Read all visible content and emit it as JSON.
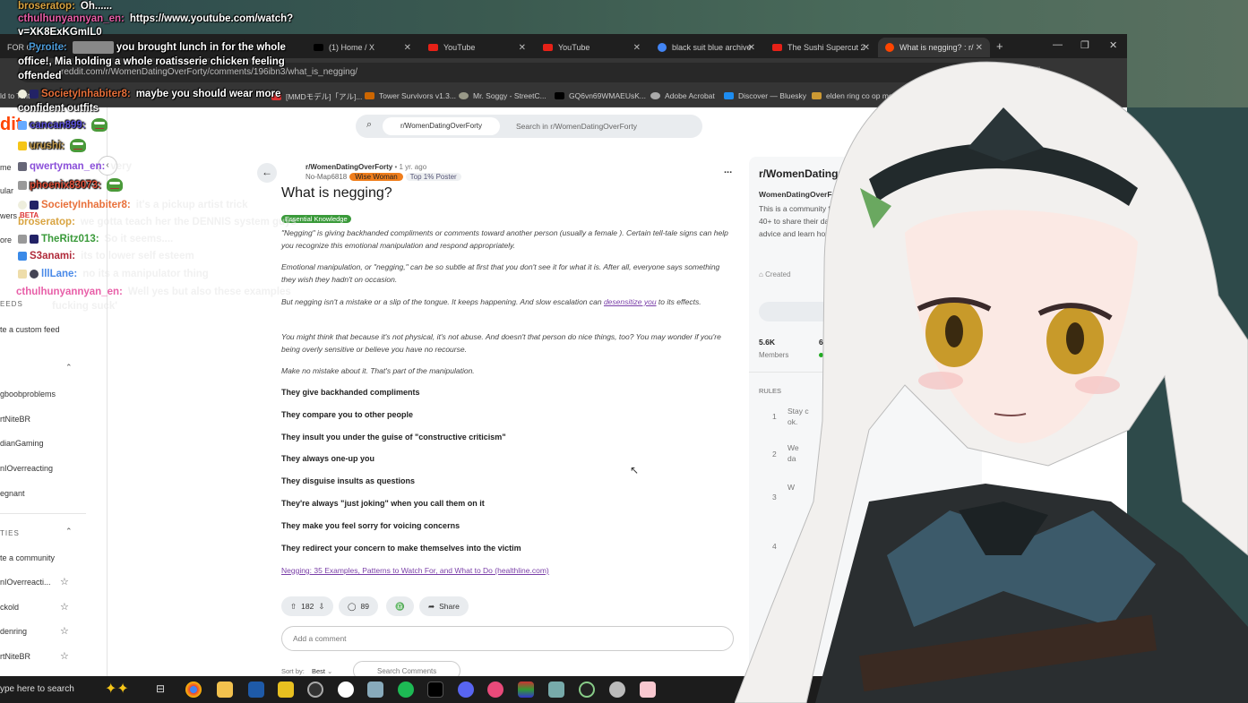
{
  "browser": {
    "tabs": [
      {
        "label": "FOR GASMAXX",
        "fav": "#888"
      },
      {
        "label": "(1) Home / X",
        "fav": "#000"
      },
      {
        "label": "YouTube",
        "fav": "#e62117"
      },
      {
        "label": "YouTube",
        "fav": "#e62117"
      },
      {
        "label": "black suit blue archive",
        "fav": "#4285f4"
      },
      {
        "label": "The Sushi Supercut 2",
        "fav": "#e62117"
      },
      {
        "label": "What is negging? : r/",
        "fav": "#ff4500"
      }
    ],
    "new_tab": "+",
    "url": "reddit.com/r/WomenDatingOverForty/comments/196ibn3/what_is_negging/",
    "bookmarks": [
      "ld to Twitch",
      "[MMDモデル]「アル]...",
      "Tower Survivors v1.3...",
      "Mr. Soggy - StreetC...",
      "GQ6vn69WMAEUsK...",
      "Adobe Acrobat",
      "Discover — Bluesky",
      "elden ring co op mod"
    ]
  },
  "reddit": {
    "logo": "dit",
    "search_chip": "r/WomenDatingOverForty",
    "search_placeholder": "Search in r/WomenDatingOverForty",
    "sidebar": {
      "top": [
        "me",
        "ular",
        "wers",
        "ore"
      ],
      "beta": "BETA",
      "feeds_header": "EEDS",
      "custom_feed": "te a custom feed",
      "recent": [
        "gboobproblems",
        "rtNiteBR",
        "dianGaming",
        "nIOverreacting",
        "egnant"
      ],
      "communities_header": "TIES",
      "create_community": "te a community",
      "communities": [
        "nIOverreacti...",
        "ckold",
        "denring",
        "rtNiteBR"
      ]
    },
    "post": {
      "subreddit": "r/WomenDatingOverForty",
      "age": "• 1 yr. ago",
      "author": "No-Map6818",
      "flair_user": "Wise Woman",
      "top_poster": "Top 1% Poster",
      "title": "What is negging?",
      "flair": "Essential Knowledge",
      "paragraphs": [
        "\"Negging\" is giving backhanded compliments or comments toward another person (usually a female ). Certain tell-tale signs can help you recognize this emotional manipulation and respond appropriately.",
        "Emotional manipulation, or \"negging,\" can be so subtle at first that you don't see it for what it is. After all, everyone says something they wish they hadn't on occasion.",
        "You might think that because it's not physical, it's not abuse. And doesn't that person do nice things, too? You may wonder if you're being overly sensitive or believe you have no recourse.",
        "Make no mistake about it. That's part of the manipulation."
      ],
      "p3_before": "But negging isn't a mistake or a slip of the tongue. It keeps happening. And slow escalation can ",
      "p3_link": "desensitize you",
      "p3_after": " to its effects.",
      "bullets": [
        "They give backhanded compliments",
        "They compare you to other people",
        "They insult you under the guise of \"constructive criticism\"",
        "They always one-up you",
        "They disguise insults as questions",
        "They're always \"just joking\" when you call them on it",
        "They make you feel sorry for voicing concerns",
        "They redirect your concern to make themselves into the victim"
      ],
      "source_link": "Negging: 35 Examples, Patterns to Watch For, and What to Do (healthline.com)",
      "votes": "182",
      "comments": "89",
      "share": "Share",
      "comment_placeholder": "Add a comment",
      "sort_label": "Sort by:",
      "sort_value": "Best",
      "search_comments": "Search Comments",
      "more": "..."
    },
    "community": {
      "name": "r/WomenDatingOver...",
      "full": "WomenDatingOverFor",
      "desc": [
        "This is a community fo",
        "40+ to share their da",
        "advice and learn how t"
      ],
      "created": "Created",
      "members": "5.6K",
      "members_label": "Members",
      "online": "6",
      "rules_header": "RULES",
      "rules": [
        {
          "n": "1",
          "t": "Stay c",
          "t2": "ok."
        },
        {
          "n": "2",
          "t": "We",
          "t2": "da"
        },
        {
          "n": "3",
          "t": "W",
          "t2": ""
        },
        {
          "n": "4",
          "t": "",
          "t2": ""
        }
      ]
    }
  },
  "chat": [
    {
      "user": "broseratop:",
      "color": "#d9a441",
      "msg": "Oh......",
      "faded": false
    },
    {
      "user": "cthulhunyannyan_en:",
      "color": "#e85fa8",
      "msg": "https://www.youtube.com/watch?",
      "msg2": "v=XK8ExKGmIL0",
      "faded": false
    },
    {
      "user": "Pyroite:",
      "color": "#4a9ad9",
      "msg": "you brought lunch in for the whole",
      "msg2": "office!, Mia holding a whole roatisserie chicken feeling",
      "msg3": "offended",
      "faded": false
    },
    {
      "user": "SocietyInhabiter8:",
      "color": "#e8703a",
      "msg": "maybe you should wear more",
      "msg2": "confident outfits",
      "faded": false
    },
    {
      "user": "cancan899:",
      "color": "#5a4fd9",
      "msg": "",
      "faded": false
    },
    {
      "user": "urushi:",
      "color": "#c8a050",
      "msg": "",
      "faded": false
    },
    {
      "user": "qwertyman_en:",
      "color": "#8a4fd9",
      "msg": "very",
      "faded": true
    },
    {
      "user": "phoenix83073:",
      "color": "#e0503a",
      "msg": "",
      "faded": false
    },
    {
      "user": "SocietyInhabiter8:",
      "color": "#e8703a",
      "msg": "it's a pickup artist trick",
      "faded": true
    },
    {
      "user": "broseratop:",
      "color": "#d9a441",
      "msg": "we gotta teach her the DENNIS system guys",
      "faded": true
    },
    {
      "user": "TheRitz013:",
      "color": "#3a9a3a",
      "msg": "So it seems....",
      "faded": true
    },
    {
      "user": "S3anami:",
      "color": "#b02a3a",
      "msg": "its to lower self esteem",
      "faded": true
    },
    {
      "user": "lllLane:",
      "color": "#4a8ae8",
      "msg": "no its a manipulator thing",
      "faded": true
    },
    {
      "user": "cthulhunyannyan_en:",
      "color": "#e85fa8",
      "msg": "Well yes but also these examples",
      "msg2": "fucking suck'",
      "faded": true
    }
  ],
  "taskbar": {
    "search": "ype here to search"
  }
}
